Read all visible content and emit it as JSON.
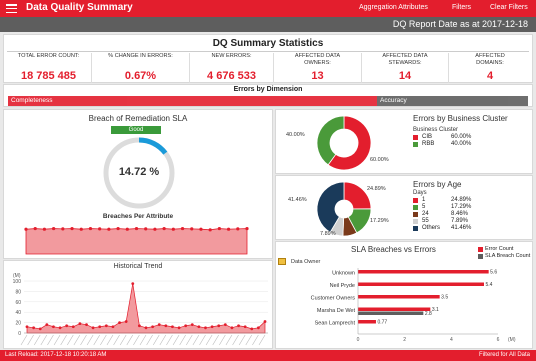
{
  "header": {
    "title": "Data Quality Summary",
    "links": [
      "Aggregation Attributes",
      "Filters",
      "Clear Filters"
    ],
    "report_date": "DQ Report Date as at 2017-12-18"
  },
  "summary": {
    "title": "DQ Summary Statistics",
    "kpis": [
      {
        "label": "TOTAL ERROR COUNT:",
        "value": "18 785 485"
      },
      {
        "label": "% CHANGE IN ERRORS:",
        "value": "0.67%"
      },
      {
        "label": "NEW ERRORS:",
        "value": "4 676 533"
      },
      {
        "label": "AFFECTED DATA OWNERS:",
        "value": "13"
      },
      {
        "label": "AFFECTED DATA STEWARDS:",
        "value": "14"
      },
      {
        "label": "AFFECTED DOMAINS:",
        "value": "4"
      }
    ]
  },
  "dimensions": {
    "title": "Errors by Dimension",
    "bars": [
      {
        "label": "Completeness",
        "fraction": 0.71,
        "color": "#e31e2d"
      },
      {
        "label": "Accuracy",
        "fraction": 0.29,
        "color": "#5e5e5e"
      }
    ]
  },
  "sla": {
    "title": "Breach of Remediation SLA",
    "badge": "Good",
    "badge_color": "#3a9a3a",
    "gauge_value": "14.72 %",
    "gauge_fraction": 0.1472,
    "per_attribute_title": "Breaches Per Attribute",
    "per_attribute_values": [
      0.8,
      0.82,
      0.8,
      0.82,
      0.81,
      0.82,
      0.8,
      0.82,
      0.81,
      0.8,
      0.82,
      0.8,
      0.82,
      0.81,
      0.8,
      0.82,
      0.8,
      0.82,
      0.81,
      0.8,
      0.78,
      0.82,
      0.8,
      0.81,
      0.82
    ]
  },
  "historical": {
    "title": "Historical Trend",
    "unit": "(M)",
    "y_ticks": [
      "100",
      "80",
      "60",
      "40",
      "20",
      "0"
    ],
    "values": [
      12,
      10,
      8,
      16,
      12,
      10,
      14,
      12,
      18,
      16,
      10,
      12,
      14,
      12,
      20,
      22,
      95,
      14,
      10,
      12,
      16,
      14,
      12,
      10,
      14,
      16,
      12,
      10,
      12,
      14,
      16,
      10,
      14,
      12,
      8,
      10,
      22
    ]
  },
  "business_cluster": {
    "title": "Errors by Business Cluster",
    "legend_title": "Business Cluster",
    "items": [
      {
        "name": "CIB",
        "pct": "60.00%",
        "value": 60,
        "color": "#e31e2d"
      },
      {
        "name": "RBB",
        "pct": "40.00%",
        "value": 40,
        "color": "#4a9a3a"
      }
    ],
    "slice_labels": [
      "60.00%",
      "40.00%"
    ]
  },
  "age": {
    "title": "Errors by Age",
    "legend_title": "Days",
    "items": [
      {
        "name": "1",
        "pct": "24.89%",
        "value": 24.89,
        "color": "#e31e2d"
      },
      {
        "name": "5",
        "pct": "17.29%",
        "value": 17.29,
        "color": "#4a9a3a"
      },
      {
        "name": "24",
        "pct": "8.46%",
        "value": 8.46,
        "color": "#7a3a1a"
      },
      {
        "name": "55",
        "pct": "7.89%",
        "value": 7.89,
        "color": "#d0d0d0"
      },
      {
        "name": "Others",
        "pct": "41.46%",
        "value": 41.46,
        "color": "#1a3a5a"
      }
    ]
  },
  "sla_breaches": {
    "title": "SLA Breaches vs Errors",
    "axis_label": "Data Owner",
    "unit": "(M)",
    "legend": [
      {
        "name": "Error Count",
        "color": "#e31e2d"
      },
      {
        "name": "SLA Breach Count",
        "color": "#5e5e5e"
      }
    ],
    "x_ticks": [
      "0",
      "2",
      "4",
      "6"
    ],
    "rows": [
      {
        "name": "Unknown",
        "error": 5.6,
        "breach": 0
      },
      {
        "name": "Neil Pryde",
        "error": 5.4,
        "breach": 0
      },
      {
        "name": "Customer Owners",
        "error": 3.5,
        "breach": 0
      },
      {
        "name": "Marsha De Wet",
        "error": 3.1,
        "breach": 2.8
      },
      {
        "name": "Sean Lamprecht",
        "error": 0.77,
        "breach": 0
      }
    ],
    "labels": [
      "5.6",
      "5.4",
      "3.5",
      "3.1",
      "2.8",
      "0.77"
    ]
  },
  "footer": {
    "last_reload": "Last Reload: 2017-12-18 10:20:18 AM",
    "filter_status": "Filtered for All Data"
  }
}
